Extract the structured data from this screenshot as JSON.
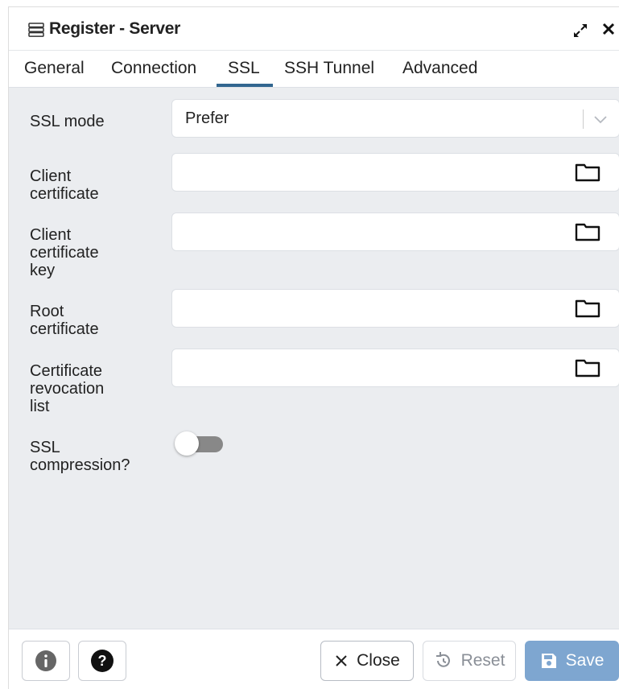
{
  "dialog": {
    "title": "Register - Server"
  },
  "tabs": [
    {
      "label": "General"
    },
    {
      "label": "Connection"
    },
    {
      "label": "SSL",
      "active": true
    },
    {
      "label": "SSH Tunnel"
    },
    {
      "label": "Advanced"
    }
  ],
  "form": {
    "ssl_mode": {
      "label": "SSL mode",
      "value": "Prefer"
    },
    "client_certificate": {
      "label_lines": [
        "Client",
        "certificate"
      ],
      "value": ""
    },
    "client_certificate_key": {
      "label_lines": [
        "Client",
        "certificate",
        "key"
      ],
      "value": ""
    },
    "root_certificate": {
      "label_lines": [
        "Root",
        "certificate"
      ],
      "value": ""
    },
    "crl": {
      "label_lines": [
        "Certificate",
        "revocation",
        "list"
      ],
      "value": ""
    },
    "ssl_compression": {
      "label_lines": [
        "SSL",
        "compression?"
      ],
      "enabled": false
    }
  },
  "footer": {
    "close_label": "Close",
    "reset_label": "Reset",
    "save_label": "Save"
  },
  "colors": {
    "accent": "#326690",
    "save_button": "#7ea6d0",
    "content_bg": "#ebedf0",
    "toggle_off": "#888888"
  },
  "icons": {
    "title": "server-icon",
    "expand": "expand-icon",
    "close": "close-icon",
    "browse": "folder-icon",
    "info": "info-icon",
    "help": "help-icon",
    "reset": "reset-icon",
    "save": "save-icon"
  }
}
